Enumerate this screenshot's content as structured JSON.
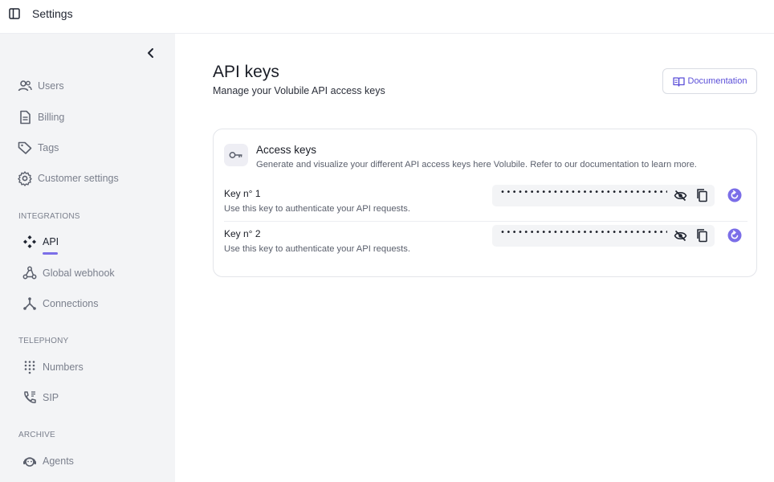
{
  "topbar": {
    "title": "Settings",
    "panel_icon": "sidebar-toggle-icon"
  },
  "sidebar": {
    "collapse_icon": "chevron-left-icon",
    "items_main": [
      {
        "label": "Users",
        "icon": "users-icon"
      },
      {
        "label": "Billing",
        "icon": "document-icon"
      },
      {
        "label": "Tags",
        "icon": "tag-icon"
      },
      {
        "label": "Customer settings",
        "icon": "gear-icon"
      }
    ],
    "sections": {
      "integrations": "INTEGRATIONS",
      "telephony": "TELEPHONY",
      "archive": "ARCHIVE"
    },
    "items_integrations": [
      {
        "label": "API",
        "icon": "api-icon",
        "active": true
      },
      {
        "label": "Global webhook",
        "icon": "webhook-icon"
      },
      {
        "label": "Connections",
        "icon": "connections-icon"
      }
    ],
    "items_telephony": [
      {
        "label": "Numbers",
        "icon": "dialpad-icon"
      },
      {
        "label": "SIP",
        "icon": "sip-phone-icon"
      }
    ],
    "items_archive": [
      {
        "label": "Agents",
        "icon": "agent-icon"
      }
    ]
  },
  "main": {
    "title": "API keys",
    "subtitle": "Manage your Volubile API access keys",
    "doc_button": {
      "label": "Documentation",
      "icon": "book-icon"
    },
    "card": {
      "title": "Access keys",
      "description": "Generate and visualize your different API access keys here Volubile. Refer to our documentation to learn more.",
      "keys": [
        {
          "name": "Key n° 1",
          "description": "Use this key to authenticate your API requests.",
          "masked": "••••••••••••••••••••••••••••••"
        },
        {
          "name": "Key n° 2",
          "description": "Use this key to authenticate your API requests.",
          "masked": "••••••••••••••••••••••••••••••"
        }
      ]
    }
  },
  "colors": {
    "accent": "#7b6ee8",
    "sidebar_bg": "#f3f4f6",
    "muted_text": "#7a7f8c"
  }
}
